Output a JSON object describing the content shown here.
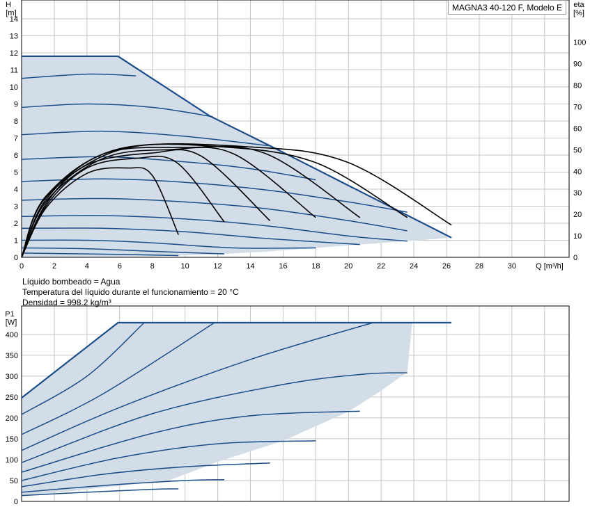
{
  "chart_data": [
    {
      "type": "line",
      "title": "",
      "xlabel": "Q [m³/h]",
      "ylabel": "H\n[m]",
      "y2label": "eta\n[%]",
      "xlim": [
        0,
        33.5
      ],
      "ylim": [
        0,
        15.1
      ],
      "y2lim": [
        0,
        119.6
      ],
      "x_ticks": [
        "0",
        "2",
        "4",
        "6",
        "8",
        "10",
        "12",
        "14",
        "16",
        "18",
        "20",
        "22",
        "24",
        "26",
        "28",
        "30"
      ],
      "y_ticks": [
        "0",
        "1",
        "2",
        "3",
        "4",
        "5",
        "6",
        "7",
        "8",
        "9",
        "10",
        "11",
        "12",
        "13",
        "14"
      ],
      "y2_ticks": [
        "0",
        "10",
        "20",
        "30",
        "40",
        "50",
        "60",
        "70",
        "80",
        "90",
        "100"
      ],
      "grid": true,
      "legend": "MAGNA3 40-120 F, Modelo E",
      "colors": {
        "head": "#1b4d89",
        "eta": "#000000",
        "area_fill": "#d3dde8",
        "grid": "#c8c8c8"
      },
      "area": [
        [
          0,
          11.8
        ],
        [
          5.9,
          11.8
        ],
        [
          11.5,
          8.3
        ],
        [
          15.5,
          6.4
        ],
        [
          26.3,
          1.15
        ],
        [
          23.6,
          0.95
        ],
        [
          20.7,
          0.75
        ],
        [
          18,
          0.55
        ],
        [
          15.2,
          0.35
        ],
        [
          12.4,
          0.2
        ],
        [
          9.6,
          0.1
        ],
        [
          8,
          0.05
        ],
        [
          0,
          0
        ]
      ],
      "envelope": [
        [
          0,
          11.8
        ],
        [
          5.9,
          11.8
        ],
        [
          11.5,
          8.3
        ],
        [
          15.5,
          6.4
        ],
        [
          26.3,
          1.15
        ]
      ],
      "head_curves": [
        [
          [
            0,
            10.5
          ],
          [
            4,
            10.75
          ],
          [
            7,
            10.65
          ]
        ],
        [
          [
            0,
            8.8
          ],
          [
            4,
            9
          ],
          [
            8,
            8.8
          ],
          [
            11.7,
            8.25
          ]
        ],
        [
          [
            0,
            7.2
          ],
          [
            5,
            7.4
          ],
          [
            10,
            7.1
          ],
          [
            15.1,
            6.55
          ]
        ],
        [
          [
            0,
            5.75
          ],
          [
            5,
            5.9
          ],
          [
            10,
            5.6
          ],
          [
            14,
            5.2
          ],
          [
            18,
            4.55
          ]
        ],
        [
          [
            0,
            4.45
          ],
          [
            5,
            4.6
          ],
          [
            10,
            4.4
          ],
          [
            15,
            3.95
          ],
          [
            20,
            3.25
          ],
          [
            23.6,
            2.65
          ]
        ],
        [
          [
            0,
            3.35
          ],
          [
            5,
            3.45
          ],
          [
            10,
            3.25
          ],
          [
            15,
            2.85
          ],
          [
            20,
            2.15
          ],
          [
            23.6,
            1.55
          ]
        ],
        [
          [
            0,
            2.4
          ],
          [
            5,
            2.45
          ],
          [
            10,
            2.25
          ],
          [
            15,
            1.85
          ],
          [
            20,
            1.25
          ],
          [
            23.6,
            0.95
          ]
        ],
        [
          [
            0,
            1.7
          ],
          [
            5,
            1.7
          ],
          [
            10,
            1.5
          ],
          [
            15,
            1.1
          ],
          [
            20.7,
            0.75
          ]
        ],
        [
          [
            0,
            1
          ],
          [
            4,
            1
          ],
          [
            8,
            0.85
          ],
          [
            13,
            0.55
          ],
          [
            18,
            0.55
          ]
        ],
        [
          [
            0,
            0.55
          ],
          [
            4,
            0.5
          ],
          [
            8,
            0.35
          ],
          [
            12.4,
            0.2
          ]
        ],
        [
          [
            0,
            0.25
          ],
          [
            4,
            0.2
          ],
          [
            7,
            0.15
          ],
          [
            9.6,
            0.1
          ]
        ]
      ],
      "eta_curves": [
        [
          [
            0,
            0
          ],
          [
            1.5,
            23
          ],
          [
            4,
            39
          ],
          [
            6.5,
            41.5
          ],
          [
            8,
            38
          ],
          [
            9.6,
            10.5
          ]
        ],
        [
          [
            0,
            0
          ],
          [
            1.5,
            24
          ],
          [
            4,
            41.5
          ],
          [
            7,
            46
          ],
          [
            9.5,
            44
          ],
          [
            12.4,
            16.5
          ]
        ],
        [
          [
            0,
            0
          ],
          [
            1.5,
            25
          ],
          [
            4,
            43
          ],
          [
            8,
            48.5
          ],
          [
            11,
            47
          ],
          [
            15.2,
            17
          ]
        ],
        [
          [
            0,
            0
          ],
          [
            1.5,
            26
          ],
          [
            5,
            46
          ],
          [
            9,
            50
          ],
          [
            13,
            48
          ],
          [
            18,
            18.5
          ]
        ],
        [
          [
            0,
            0
          ],
          [
            1.5,
            27
          ],
          [
            5,
            48
          ],
          [
            10,
            51
          ],
          [
            15,
            48
          ],
          [
            20.7,
            18.5
          ]
        ],
        [
          [
            0,
            0
          ],
          [
            1.5,
            28
          ],
          [
            6,
            50
          ],
          [
            12,
            51.5
          ],
          [
            18,
            44
          ],
          [
            23.6,
            18.5
          ]
        ],
        [
          [
            0,
            0
          ],
          [
            1.5,
            28.5
          ],
          [
            6,
            50.5
          ],
          [
            14,
            51.3
          ],
          [
            20,
            44
          ],
          [
            26.3,
            15
          ]
        ]
      ]
    },
    {
      "type": "line",
      "title": "",
      "xlabel": "",
      "ylabel": "P1\n[W]",
      "xlim": [
        0,
        33.5
      ],
      "ylim": [
        0,
        468
      ],
      "y_ticks": [
        "0",
        "50",
        "100",
        "150",
        "200",
        "250",
        "300",
        "350",
        "400"
      ],
      "grid": true,
      "colors": {
        "power": "#1b4d89",
        "area_fill": "#d3dde8"
      },
      "area": [
        [
          0,
          248
        ],
        [
          5.9,
          428
        ],
        [
          23.9,
          428
        ],
        [
          23.6,
          310
        ],
        [
          22,
          265
        ],
        [
          20,
          215
        ],
        [
          18,
          180
        ],
        [
          16,
          145
        ],
        [
          12,
          95
        ],
        [
          9,
          50
        ],
        [
          0,
          12
        ]
      ],
      "envelope": [
        [
          0,
          248
        ],
        [
          5.9,
          428
        ],
        [
          26.3,
          428
        ]
      ],
      "power_curves": [
        [
          [
            0,
            208
          ],
          [
            4,
            300
          ],
          [
            7.5,
            428
          ]
        ],
        [
          [
            0,
            160
          ],
          [
            5,
            258
          ],
          [
            11.8,
            428
          ]
        ],
        [
          [
            0,
            122
          ],
          [
            6,
            225
          ],
          [
            14,
            340
          ],
          [
            21.5,
            428
          ]
        ],
        [
          [
            0,
            93
          ],
          [
            8,
            210
          ],
          [
            16,
            280
          ],
          [
            21,
            305
          ],
          [
            23.6,
            308
          ]
        ],
        [
          [
            0,
            70
          ],
          [
            8,
            163
          ],
          [
            14,
            205
          ],
          [
            20.7,
            216
          ]
        ],
        [
          [
            0,
            50
          ],
          [
            6,
            105
          ],
          [
            12,
            138
          ],
          [
            18,
            145
          ]
        ],
        [
          [
            0,
            35
          ],
          [
            5,
            65
          ],
          [
            10,
            83
          ],
          [
            15.2,
            92
          ]
        ],
        [
          [
            0,
            22
          ],
          [
            5,
            38
          ],
          [
            10,
            50
          ],
          [
            12.4,
            52
          ]
        ],
        [
          [
            0,
            14
          ],
          [
            4,
            22
          ],
          [
            8,
            29
          ],
          [
            9.6,
            30
          ]
        ]
      ]
    }
  ],
  "info": {
    "liquid": "Líquido bombeado = Agua",
    "temperature": "Temperatura del líquido durante el funcionamiento = 20 °C",
    "density": "Densidad = 998.2 kg/m³"
  }
}
